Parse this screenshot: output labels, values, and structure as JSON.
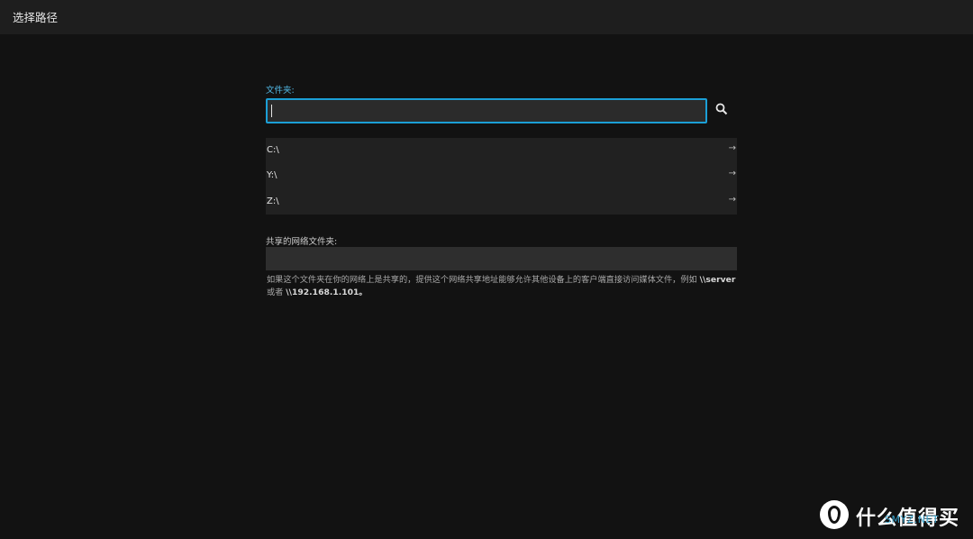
{
  "header": {
    "title": "选择路径",
    "back_icon": "chevron-left-icon"
  },
  "folder": {
    "label": "文件夹:",
    "value": "",
    "search_icon": "search-icon"
  },
  "drives": [
    {
      "name": "C:\\",
      "icon": "arrow-right-icon"
    },
    {
      "name": "Y:\\",
      "icon": "arrow-right-icon"
    },
    {
      "name": "Z:\\",
      "icon": "arrow-right-icon"
    }
  ],
  "shared": {
    "label": "共享的网络文件夹:",
    "value": "",
    "help_prefix": "如果这个文件夹在你的网络上是共享的，提供这个网络共享地址能够允许其他设备上的客户端直接访问媒体文件，例如 ",
    "help_example1": "\\\\server",
    "help_or": " 或者 ",
    "help_example2": "\\\\192.168.1.101",
    "help_suffix": "。"
  },
  "watermark": {
    "logo_char": "值",
    "text": "什么值得买",
    "site": "SMYZ.NET"
  },
  "colors": {
    "accent": "#1b9fd6",
    "background": "#121212",
    "titlebar": "#1e1e1e"
  }
}
